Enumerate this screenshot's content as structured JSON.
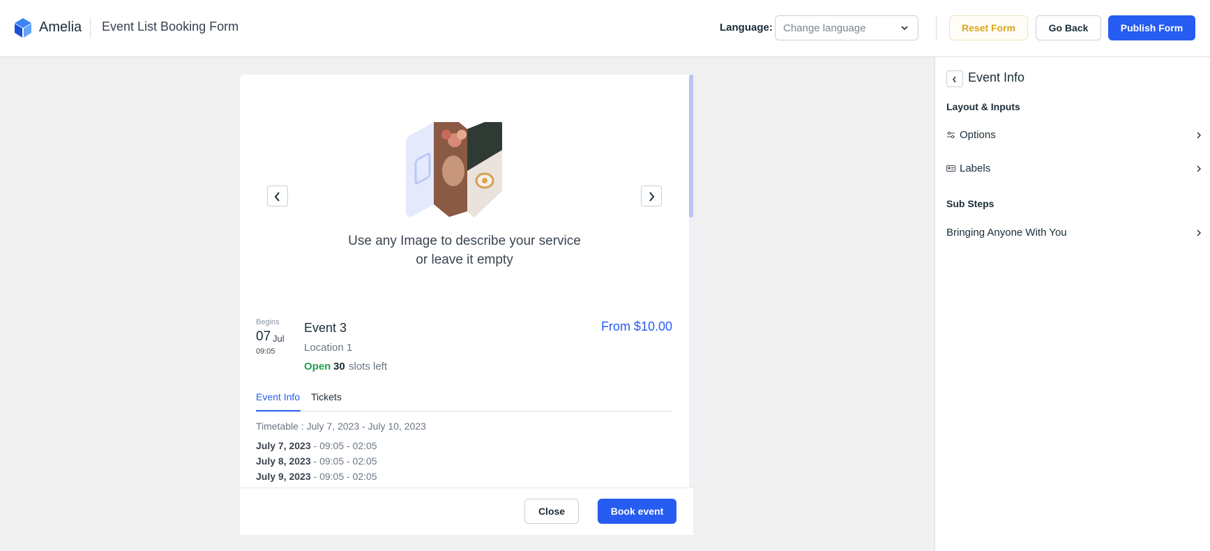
{
  "header": {
    "brand": "Amelia",
    "form_title": "Event List Booking Form",
    "language_label": "Language:",
    "language_placeholder": "Change language",
    "reset_label": "Reset Form",
    "back_label": "Go Back",
    "publish_label": "Publish Form"
  },
  "panel": {
    "title": "Event Info",
    "section_layout": "Layout & Inputs",
    "items": [
      {
        "label": "Options",
        "icon": "sliders-icon"
      },
      {
        "label": "Labels",
        "icon": "label-card-icon"
      }
    ],
    "section_substeps": "Sub Steps",
    "substep_item": "Bringing Anyone With You"
  },
  "card": {
    "image_text_line1": "Use any Image to describe your service",
    "image_text_line2": "or leave it empty",
    "begins_label": "Begins",
    "day": "07",
    "month": "Jul",
    "time": "09:05",
    "event_name": "Event 3",
    "location": "Location 1",
    "status": "Open",
    "slots_count": "30",
    "slots_text": "slots left",
    "price": "From $10.00",
    "tabs": [
      "Event Info",
      "Tickets"
    ],
    "timetable": "Timetable : July 7, 2023 - July 10, 2023",
    "schedule": [
      {
        "date": "July 7, 2023",
        "time": " - 09:05 - 02:05"
      },
      {
        "date": "July 8, 2023",
        "time": " - 09:05 - 02:05"
      },
      {
        "date": "July 9, 2023",
        "time": " - 09:05 - 02:05"
      }
    ],
    "close_label": "Close",
    "book_label": "Book event"
  },
  "colors": {
    "primary": "#265cf2",
    "open_status": "#23a24d",
    "reset_text": "#d9a520",
    "background": "#f0f0f0"
  }
}
